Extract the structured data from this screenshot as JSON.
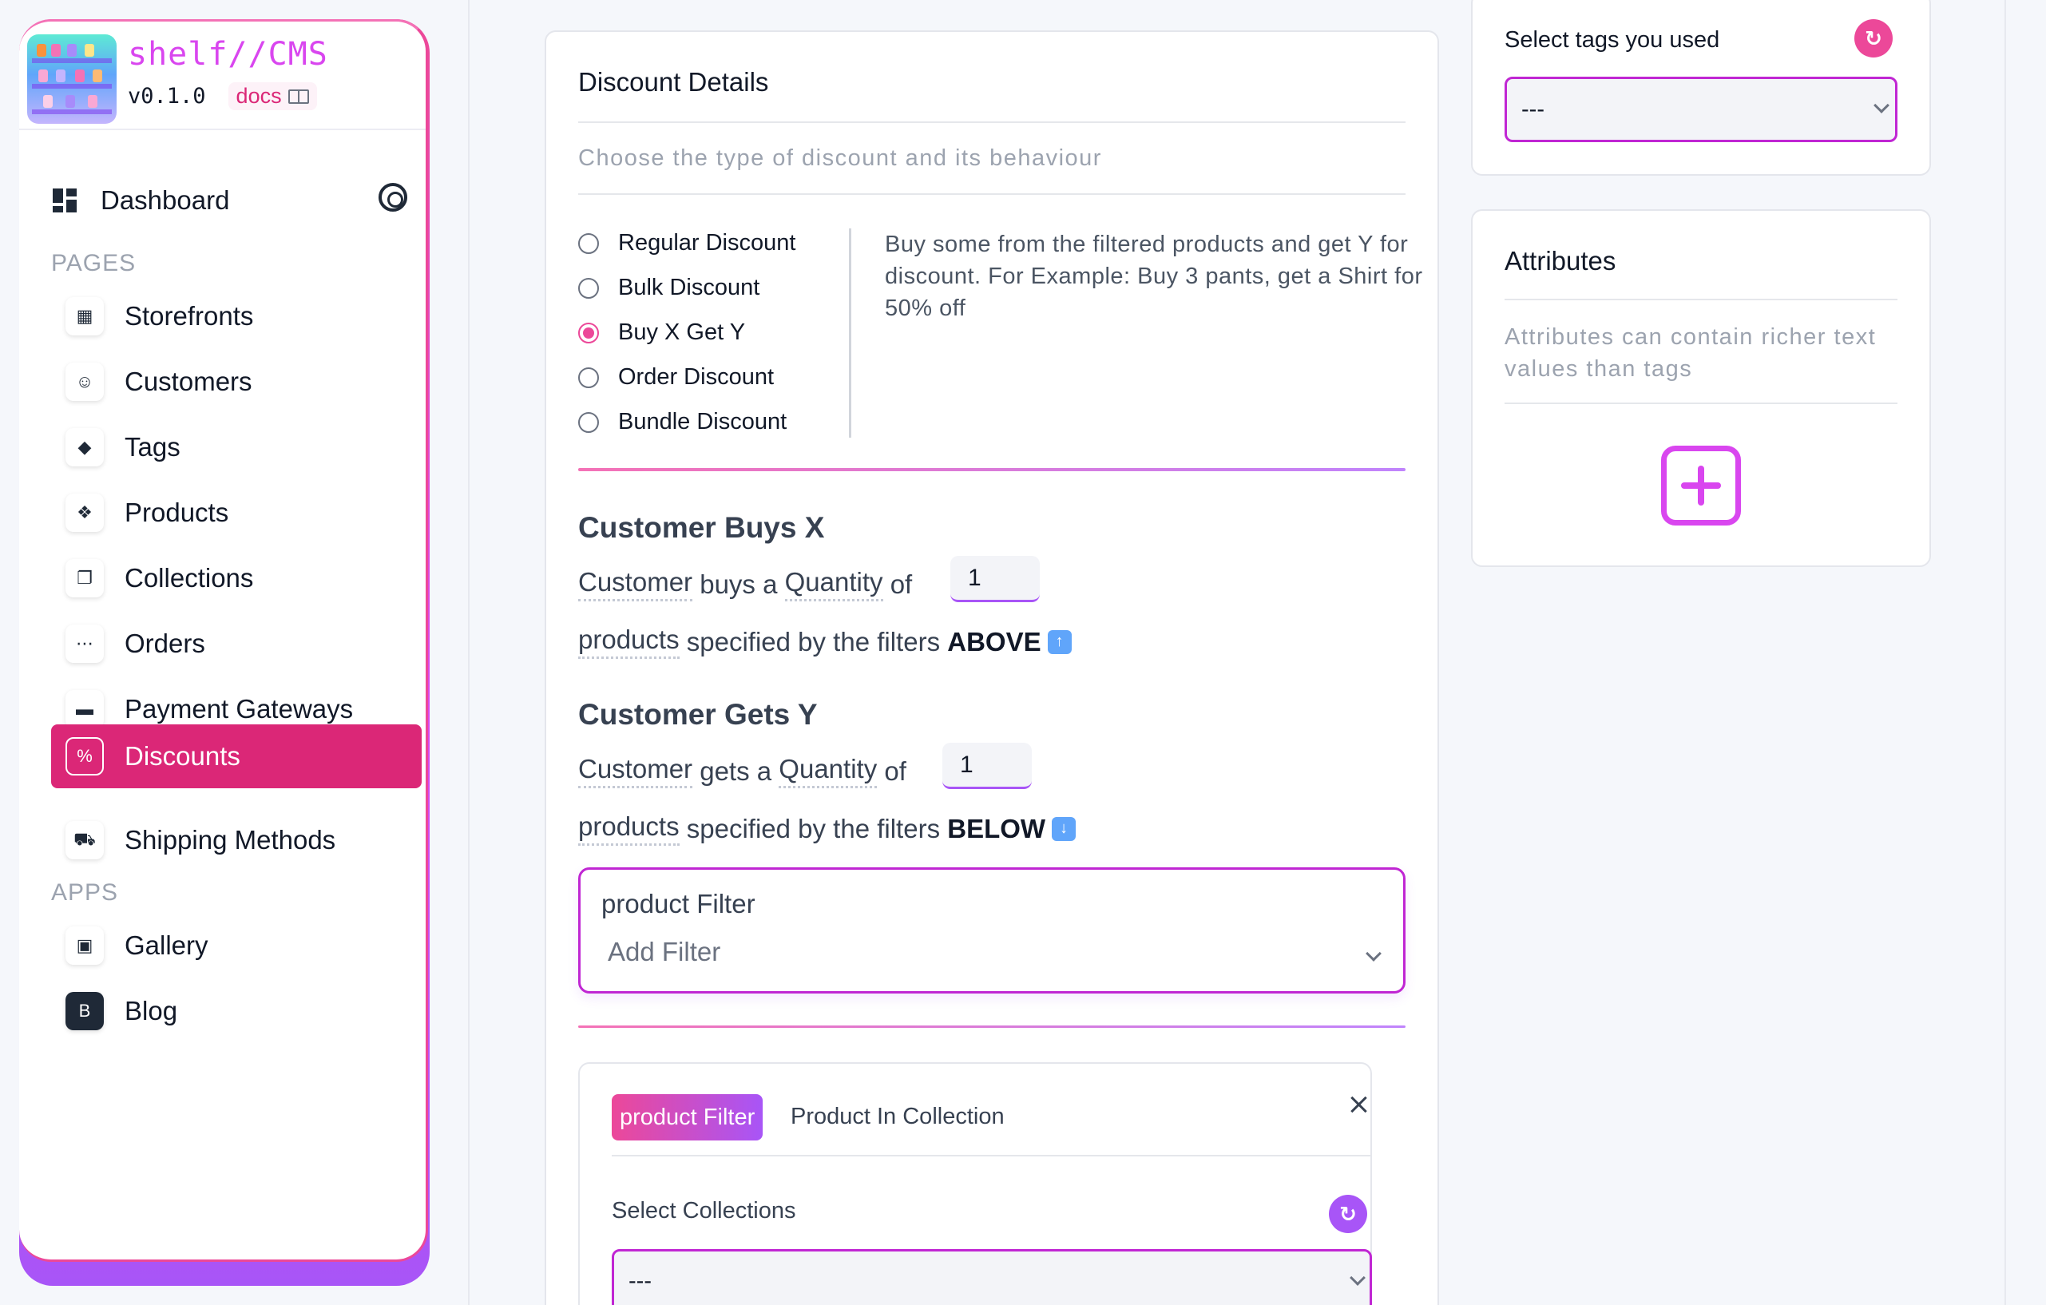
{
  "sidebar": {
    "brand": {
      "name": "shelf//CMS",
      "version": "v0.1.0",
      "docs_label": "docs"
    },
    "dashboard_label": "Dashboard",
    "pages_heading": "PAGES",
    "apps_heading": "APPS",
    "pages": [
      {
        "label": "Storefronts",
        "icon": "storefront-icon"
      },
      {
        "label": "Customers",
        "icon": "user-icon"
      },
      {
        "label": "Tags",
        "icon": "tag-icon"
      },
      {
        "label": "Products",
        "icon": "products-icon"
      },
      {
        "label": "Collections",
        "icon": "collections-icon"
      },
      {
        "label": "Orders",
        "icon": "cart-icon"
      },
      {
        "label": "Payment Gateways",
        "icon": "credit-card-icon"
      },
      {
        "label": "Discounts",
        "icon": "discount-icon",
        "active": true
      },
      {
        "label": "Shipping Methods",
        "icon": "truck-icon"
      }
    ],
    "apps": [
      {
        "label": "Gallery",
        "icon": "gallery-icon"
      },
      {
        "label": "Blog",
        "icon": "blog-icon"
      }
    ]
  },
  "discount": {
    "title": "Discount Details",
    "subtitle": "Choose the type of discount and its behaviour",
    "types": [
      {
        "label": "Regular Discount",
        "checked": false
      },
      {
        "label": "Bulk Discount",
        "checked": false
      },
      {
        "label": "Buy X Get Y",
        "checked": true
      },
      {
        "label": "Order Discount",
        "checked": false
      },
      {
        "label": "Bundle Discount",
        "checked": false
      }
    ],
    "description": "Buy some from the filtered products and get Y for discount. For Example: Buy 3 pants, get a Shirt for 50% off",
    "buys": {
      "heading": "Customer Buys X",
      "w1": "Customer",
      "w2": "buys a",
      "w3": "Quantity",
      "w4": "of",
      "quantity": "1",
      "p1": "products",
      "p2": "specified by the filters",
      "p3": "ABOVE"
    },
    "gets": {
      "heading": "Customer Gets Y",
      "w1": "Customer",
      "w2": "gets a",
      "w3": "Quantity",
      "w4": "of",
      "quantity": "1",
      "p1": "products",
      "p2": "specified by the filters",
      "p3": "BELOW"
    },
    "filter": {
      "label": "product Filter",
      "value": "Add Filter"
    },
    "filter_card": {
      "pill": "product Filter",
      "name": "Product In Collection",
      "select_label": "Select Collections",
      "select_value": "---"
    }
  },
  "tags": {
    "label": "Select tags you used",
    "select_value": "---"
  },
  "attributes": {
    "title": "Attributes",
    "description": "Attributes can contain richer text values than tags"
  },
  "colors": {
    "accent": "#db2777",
    "accent2": "#a855f7"
  }
}
